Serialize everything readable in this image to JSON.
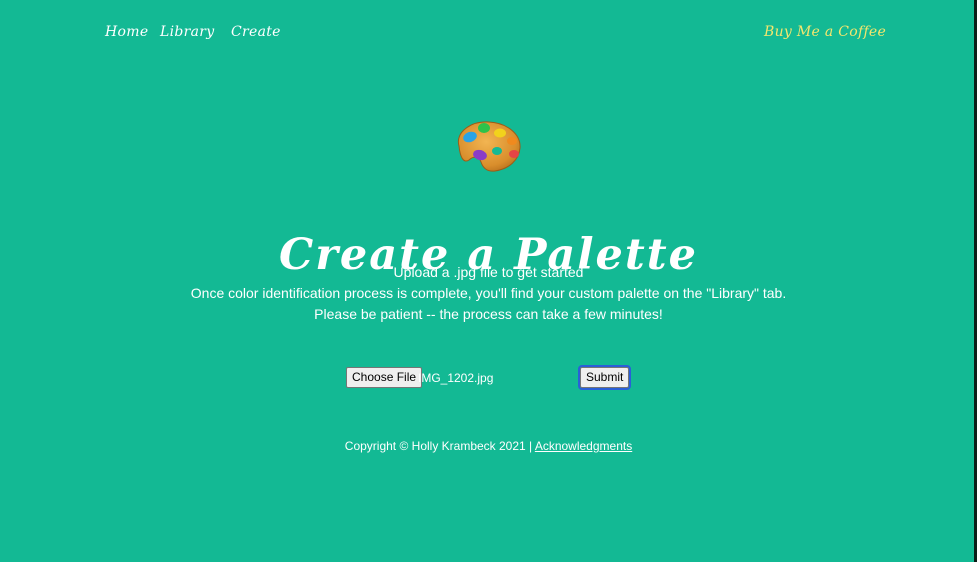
{
  "nav": {
    "home": "Home",
    "library": "Library",
    "create": "Create",
    "coffee": "Buy Me a Coffee"
  },
  "hero": {
    "icon": "artist-palette-icon",
    "title": "Create a Palette"
  },
  "instructions": {
    "line1": "Upload a .jpg file to get started",
    "line2": "Once color identification process is complete, you'll find your custom palette on the \"Library\" tab.",
    "line3": "Please be patient -- the process can take a few minutes!"
  },
  "upload": {
    "choose_label": "Choose File",
    "file_name": "IMG_1202.jpg",
    "submit_label": "Submit"
  },
  "footer": {
    "copyright": "Copyright © Holly Krambeck 2021 |",
    "link": "Acknowledgments"
  },
  "colors": {
    "background": "#13b994",
    "text": "#ffffff",
    "accent": "#f3e66e",
    "focus": "#2a5fd8"
  }
}
